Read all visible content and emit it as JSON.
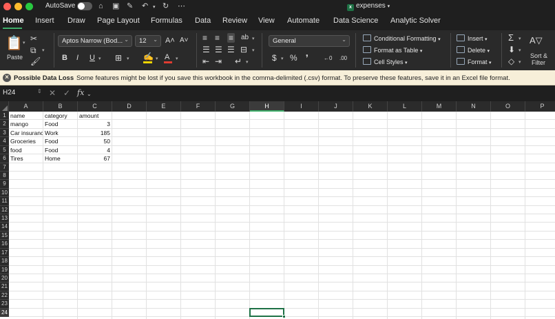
{
  "titlebar": {
    "autosave_label": "AutoSave",
    "autosave_on": false,
    "document_title": "expenses",
    "icons": [
      "home-icon",
      "save-icon",
      "save-as-icon",
      "undo-icon",
      "redo-icon",
      "more-icon"
    ]
  },
  "ribbon_tabs": [
    {
      "label": "Home",
      "active": true
    },
    {
      "label": "Insert"
    },
    {
      "label": "Draw"
    },
    {
      "label": "Page Layout"
    },
    {
      "label": "Formulas"
    },
    {
      "label": "Data"
    },
    {
      "label": "Review"
    },
    {
      "label": "View"
    },
    {
      "label": "Automate"
    },
    {
      "label": "Data Science"
    },
    {
      "label": "Analytic Solver"
    }
  ],
  "ribbon": {
    "paste_label": "Paste",
    "font_name": "Aptos Narrow (Bod...",
    "font_size": "12",
    "number_format": "General",
    "bold": "B",
    "italic": "I",
    "underline": "U",
    "currency": "$",
    "percent": "%",
    "comma": "❜",
    "conditional_formatting": "Conditional Formatting",
    "format_as_table": "Format as Table",
    "cell_styles": "Cell Styles",
    "insert": "Insert",
    "delete": "Delete",
    "format": "Format",
    "sort_filter": "Sort &",
    "sort_filter_2": "Filter",
    "font_color": "#e03c31",
    "highlight_color": "#f2d600",
    "accent": "#3fae6a"
  },
  "message_bar": {
    "title": "Possible Data Loss",
    "text": "Some features might be lost if you save this workbook in the comma-delimited (.csv) format. To preserve these features, save it in an Excel file format."
  },
  "formula_bar": {
    "name_box": "H24",
    "fx": "fx",
    "formula": ""
  },
  "sheet": {
    "columns": [
      "A",
      "B",
      "C",
      "D",
      "E",
      "F",
      "G",
      "H",
      "I",
      "J",
      "K",
      "L",
      "M",
      "N",
      "O",
      "P"
    ],
    "selected_column": "H",
    "rows": [
      "1",
      "2",
      "3",
      "4",
      "5",
      "6",
      "7",
      "8",
      "9",
      "10",
      "11",
      "12",
      "13",
      "14",
      "15",
      "16",
      "17",
      "18",
      "19",
      "20",
      "21",
      "22",
      "23",
      "24"
    ],
    "selected_row": "24",
    "selected_cell": "H24",
    "data": [
      [
        "name",
        "category",
        "amount"
      ],
      [
        "mango",
        "Food",
        "3"
      ],
      [
        "Car insurance",
        "Work",
        "185"
      ],
      [
        "Groceries",
        "Food",
        "50"
      ],
      [
        "food",
        "Food",
        "4"
      ],
      [
        "Tires",
        "Home",
        "67"
      ]
    ]
  }
}
